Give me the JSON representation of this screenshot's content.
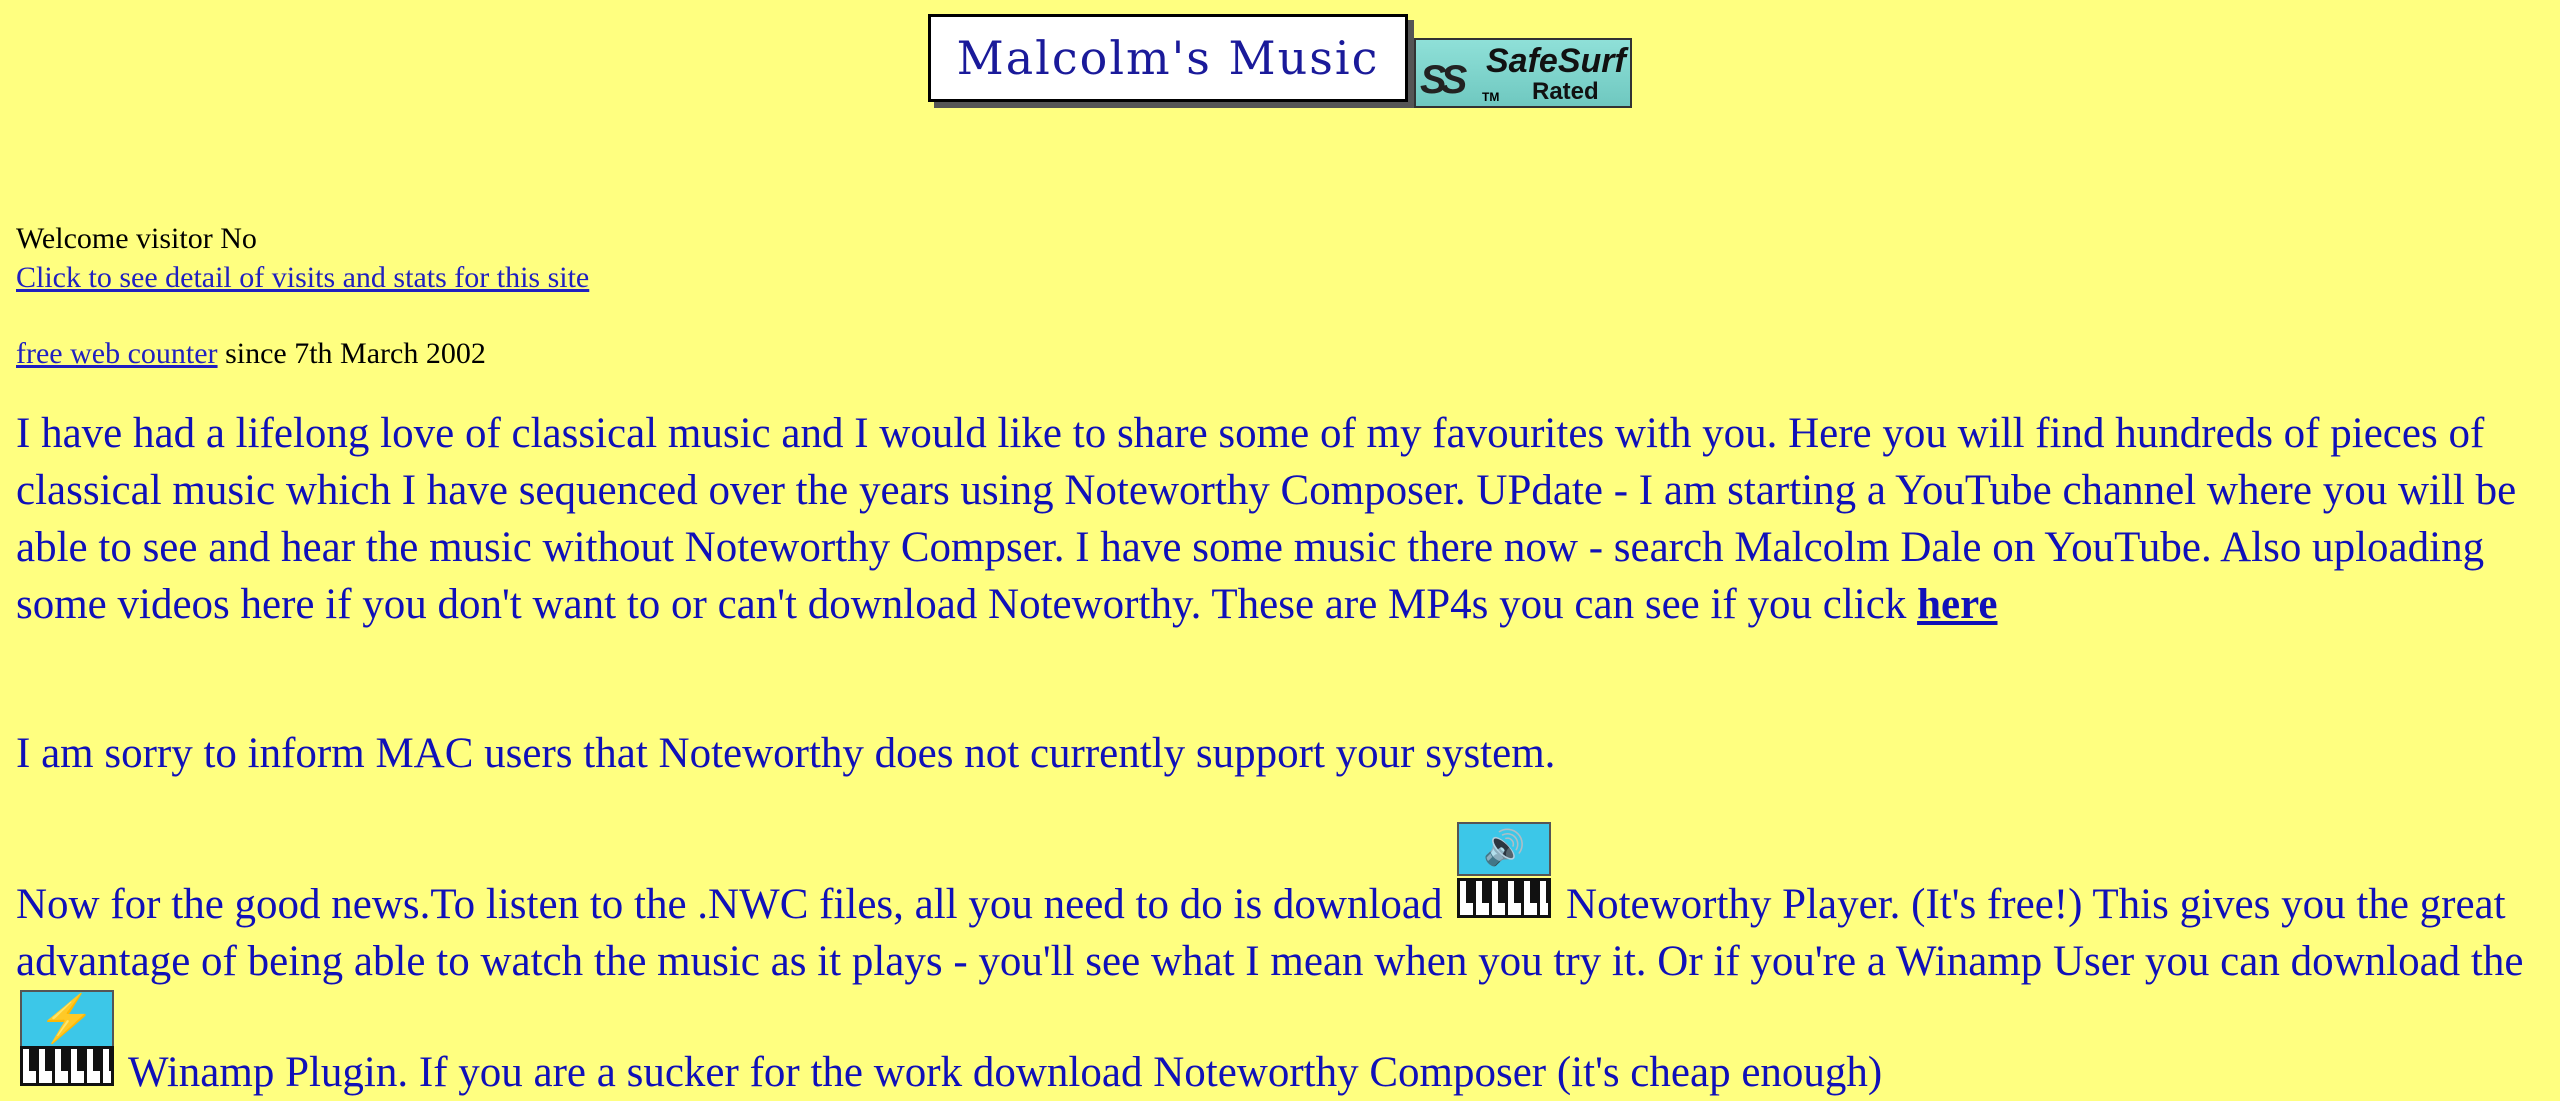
{
  "header": {
    "logo_text": "Malcolm's Music",
    "safesurf": {
      "name": "SafeSurf",
      "tm": "TM",
      "rated": "Rated",
      "mark": "SS"
    }
  },
  "visitor": {
    "welcome": "Welcome visitor No",
    "stats_link": "Click to see detail of visits and stats for this site",
    "counter_link": "free web counter",
    "counter_since": " since 7th March 2002"
  },
  "intro": {
    "text": "I have had a lifelong love of classical music and I would like to share some of my favourites with you. Here you will find hundreds of pieces of classical music which I have sequenced over the years using Noteworthy Composer. UPdate - I am starting a YouTube channel where you will be able to see and hear the music without Noteworthy Compser. I have some music there now - search Malcolm Dale on YouTube. Also uploading some videos here if you don't want to or can't download Noteworthy. These are MP4s you can see if you click ",
    "here_link": "here"
  },
  "mac_notice": "I am sorry to inform MAC users that Noteworthy does not currently support your system.",
  "news": {
    "part1": "Now for the good news.To listen to the .NWC files, all you need to do is download ",
    "part2": " Noteworthy Player. (It's free!) This gives you the great advantage of being able to watch the music as it plays - you'll see what I mean when you try it. Or if you're a Winamp User you can download the ",
    "part3": " Winamp Plugin. If you are a sucker for the work download Noteworthy Composer (it's cheap enough)",
    "icons": {
      "player": "noteworthy-player-icon",
      "winamp": "winamp-plugin-icon"
    }
  }
}
